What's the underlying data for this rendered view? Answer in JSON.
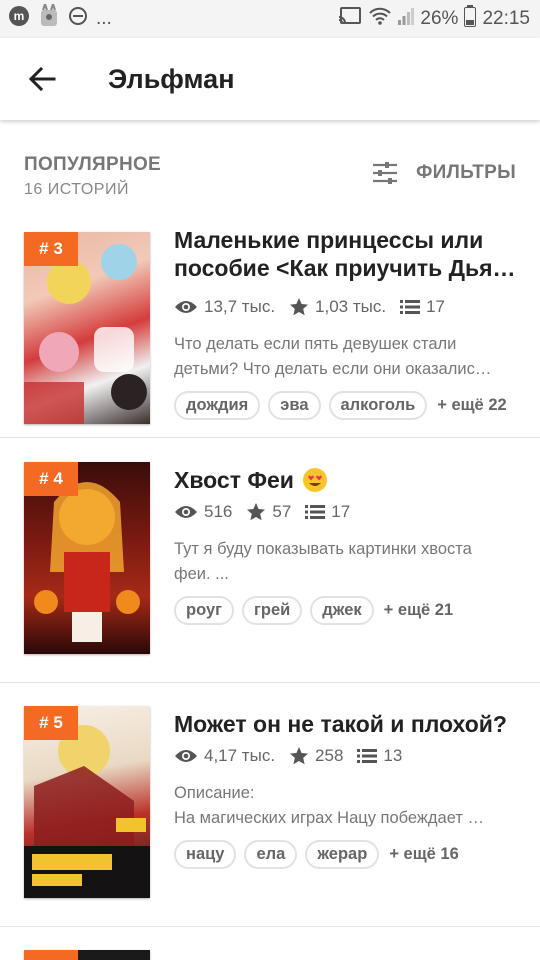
{
  "status_bar": {
    "battery": "26%",
    "time": "22:15",
    "dots": "..."
  },
  "header": {
    "title": "Эльфман"
  },
  "section": {
    "title": "ПОПУЛЯРНОЕ",
    "count": "16 ИСТОРИЙ",
    "filters_label": "ФИЛЬТРЫ"
  },
  "stories": [
    {
      "rank": "# 3",
      "title_line1": "Маленькие принцессы или",
      "title_line2": "пособие <Как приучить Дья…",
      "views": "13,7 тыс.",
      "votes": "1,03 тыс.",
      "parts": "17",
      "desc_line1": "Что делать если пять девушек стали",
      "desc_line2": "детьми? Что делать если они оказалис…",
      "tags": [
        "дождия",
        "эва",
        "алкоголь"
      ],
      "more": "+ ещё 22"
    },
    {
      "rank": "# 4",
      "title": "Хвост Феи",
      "views": "516",
      "votes": "57",
      "parts": "17",
      "desc_line1": "Тут я буду показывать картинки хвоста",
      "desc_line2": "феи. ...",
      "tags": [
        "роуг",
        "грей",
        "джек"
      ],
      "more": "+ ещё 21"
    },
    {
      "rank": "# 5",
      "title": "Может он не такой и плохой?",
      "views": "4,17 тыс.",
      "votes": "258",
      "parts": "13",
      "desc_line1": "Описание:",
      "desc_line2": "На магических играх Нацу побеждает …",
      "tags": [
        "нацу",
        "ела",
        "жерар"
      ],
      "more": "+ ещё 16"
    }
  ],
  "colors": {
    "accent": "#f46a23",
    "text_dark": "#222222",
    "text_muted": "#777777"
  }
}
